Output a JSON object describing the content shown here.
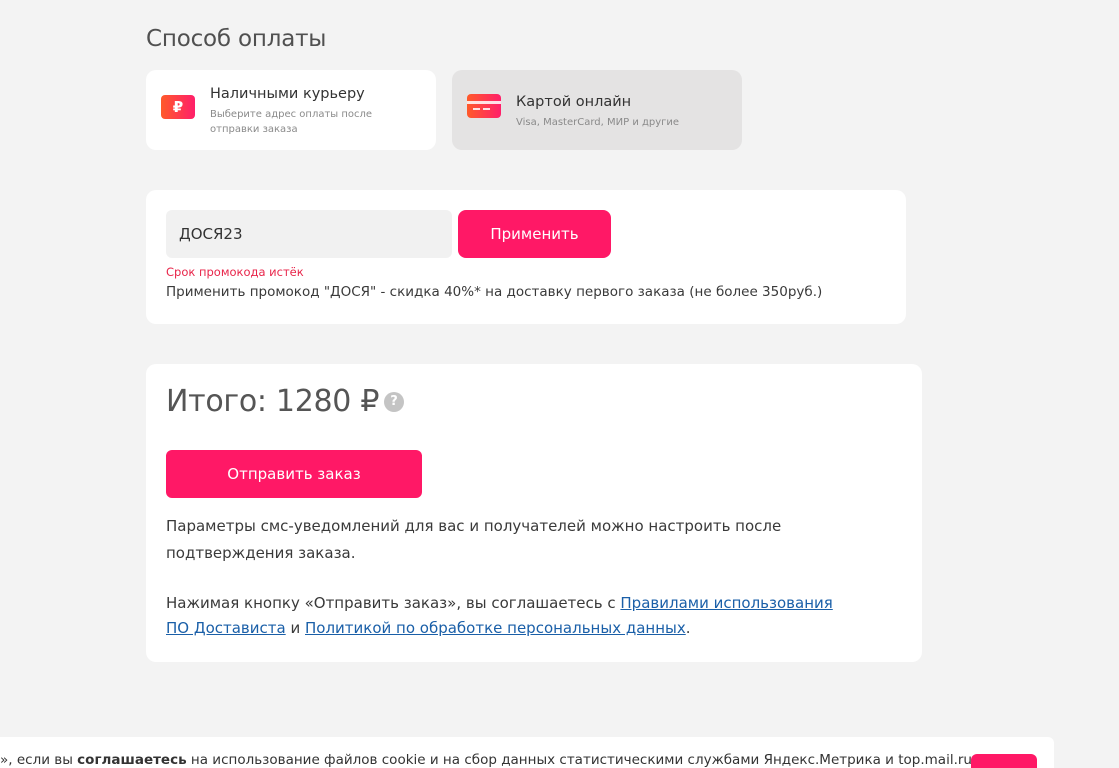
{
  "payment": {
    "title": "Способ оплаты",
    "options": [
      {
        "label": "Наличными курьеру",
        "sub": "Выберите адрес оплаты после отправки заказа",
        "icon": "ruble-icon"
      },
      {
        "label": "Картой онлайн",
        "sub": "Visa, MasterCard, МИР и другие",
        "icon": "credit-card-icon"
      }
    ],
    "selected": "Картой онлайн"
  },
  "promo": {
    "value": "ДОСЯ23",
    "apply_label": "Применить",
    "error": "Срок промокода истёк",
    "hint": "Применить промокод \"ДОСЯ\" - скидка 40%* на доставку первого заказа (не более 350руб.)"
  },
  "total": {
    "text": "Итого: 1280 ₽",
    "help_glyph": "?",
    "submit_label": "Отправить заказ",
    "sms_note": "Параметры смс-уведомлений для вас и получателей можно настроить после подтверждения заказа.",
    "agree_prefix": "Нажимая кнопку «Отправить заказ», вы соглашаетесь с ",
    "agree_link_rules": "Правилами использования ПО Достависта",
    "agree_and": " и ",
    "agree_link_privacy": "Политикой по обработке персональных данных",
    "agree_suffix": "."
  },
  "cookie": {
    "prefix": "», если вы ",
    "bold": "соглашаетесь",
    "suffix": " на использование файлов cookie и на сбор данных статистическими службами Яндекс.Метрика и top.mail.ru"
  },
  "colors": {
    "accent": "#ff1866",
    "link": "#1a5fa8",
    "error": "#e8254a",
    "background": "#f3f3f3"
  }
}
